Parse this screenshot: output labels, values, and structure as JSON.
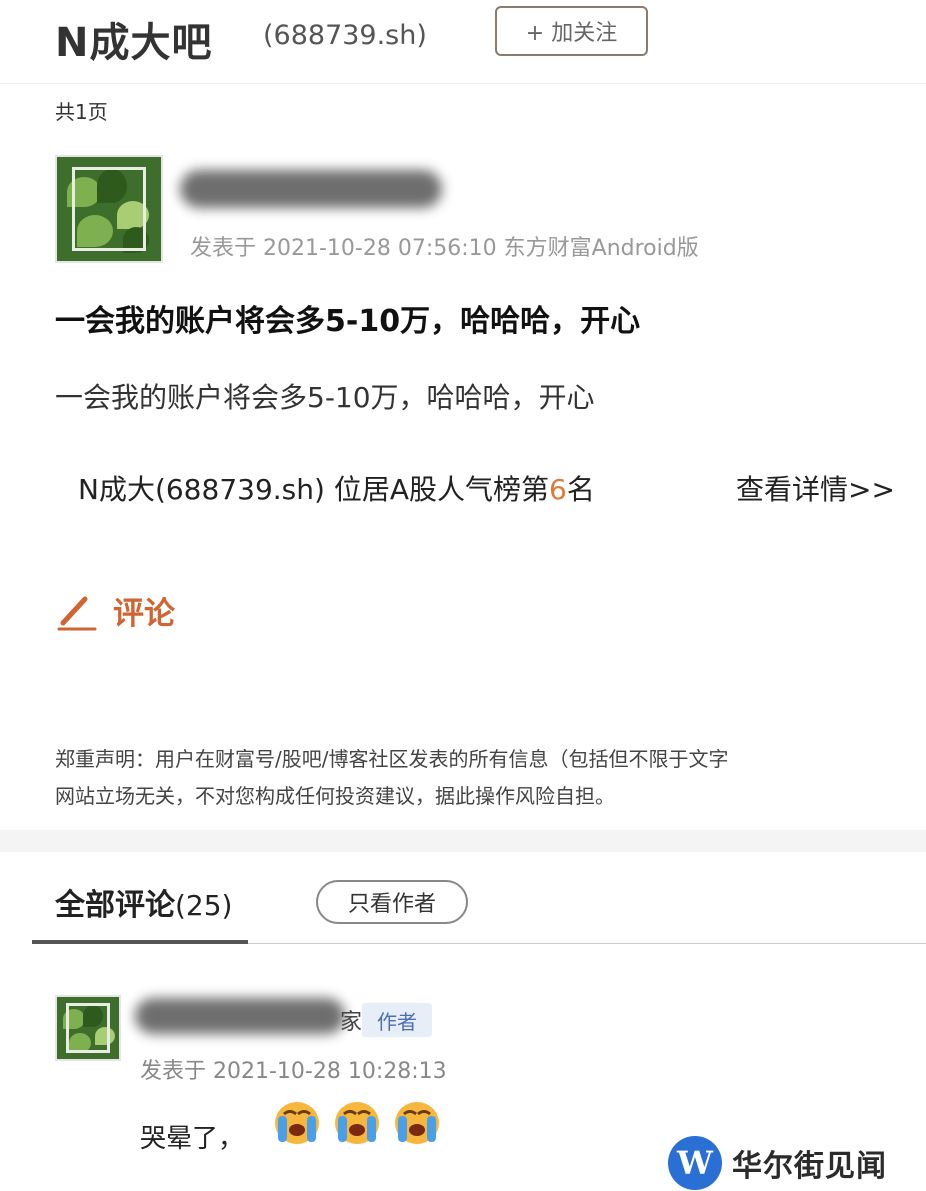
{
  "header": {
    "bar_title": "N成大吧",
    "stock_code": "(688739.sh)",
    "follow_label": "+ 加关注"
  },
  "page_count": "共1页",
  "post": {
    "meta": "发表于 2021-10-28 07:56:10 东方财富Android版",
    "title": "一会我的账户将会多5-10万，哈哈哈，开心",
    "body": "一会我的账户将会多5-10万，哈哈哈，开心",
    "rank_prefix": "N成大(688739.sh) 位居A股人气榜第",
    "rank_number": "6",
    "rank_suffix": "名",
    "rank_link": "查看详情>>"
  },
  "comment_action": {
    "label": "评论",
    "icon": "pencil-icon"
  },
  "disclaimer": {
    "line1": "郑重声明：用户在财富号/股吧/博客社区发表的所有信息（包括但不限于文字",
    "line2": "网站立场无关，不对您构成任何投资建议，据此操作风险自担。"
  },
  "comments_section": {
    "tab_label": "全部评论",
    "tab_count": "(25)",
    "only_author_label": "只看作者"
  },
  "comment": {
    "name_tail": "家",
    "author_tag": "作者",
    "meta": "发表于 2021-10-28 10:28:13",
    "text": "哭晕了，",
    "emoji_icons": [
      "crying-face-icon",
      "crying-face-icon",
      "crying-face-icon"
    ]
  },
  "watermark": {
    "logo_letter": "W",
    "text": "华尔街见闻"
  },
  "colors": {
    "accent_orange": "#d06432",
    "rank_number": "#e07a3a",
    "author_tag_bg": "#e8eef8",
    "author_tag_text": "#4a6fb5",
    "watermark_blue": "#2a6fd3"
  }
}
